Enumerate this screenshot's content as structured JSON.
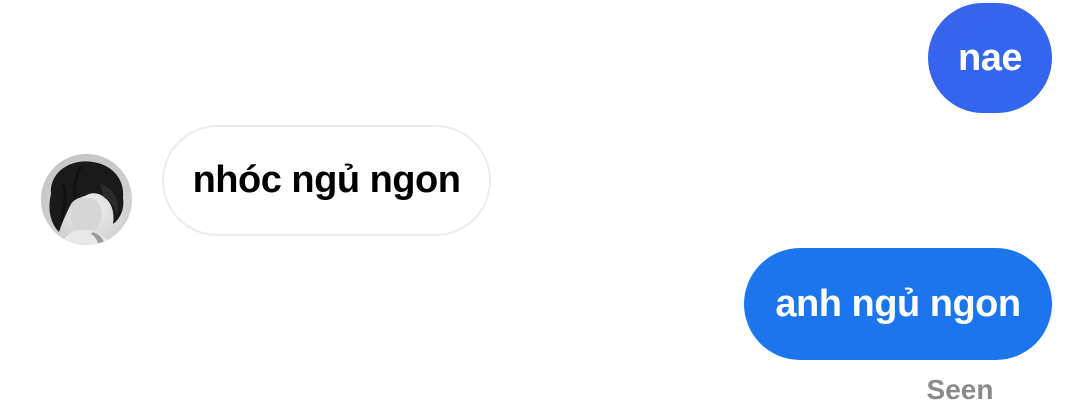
{
  "conversation": {
    "messages": [
      {
        "direction": "outgoing",
        "text": "nae"
      },
      {
        "direction": "incoming",
        "text": "nhóc ngủ ngon"
      },
      {
        "direction": "outgoing",
        "text": "anh ngủ ngon"
      }
    ],
    "status": "Seen"
  },
  "avatar": {
    "icon": "profile-photo-grayscale"
  },
  "colors": {
    "outgoing_bubble_top": "#3A64EC",
    "outgoing_bubble": "#1B76EE",
    "incoming_bubble": "#FFFFFF",
    "incoming_border": "#ECECEC",
    "status_text": "#8A8A8A"
  }
}
